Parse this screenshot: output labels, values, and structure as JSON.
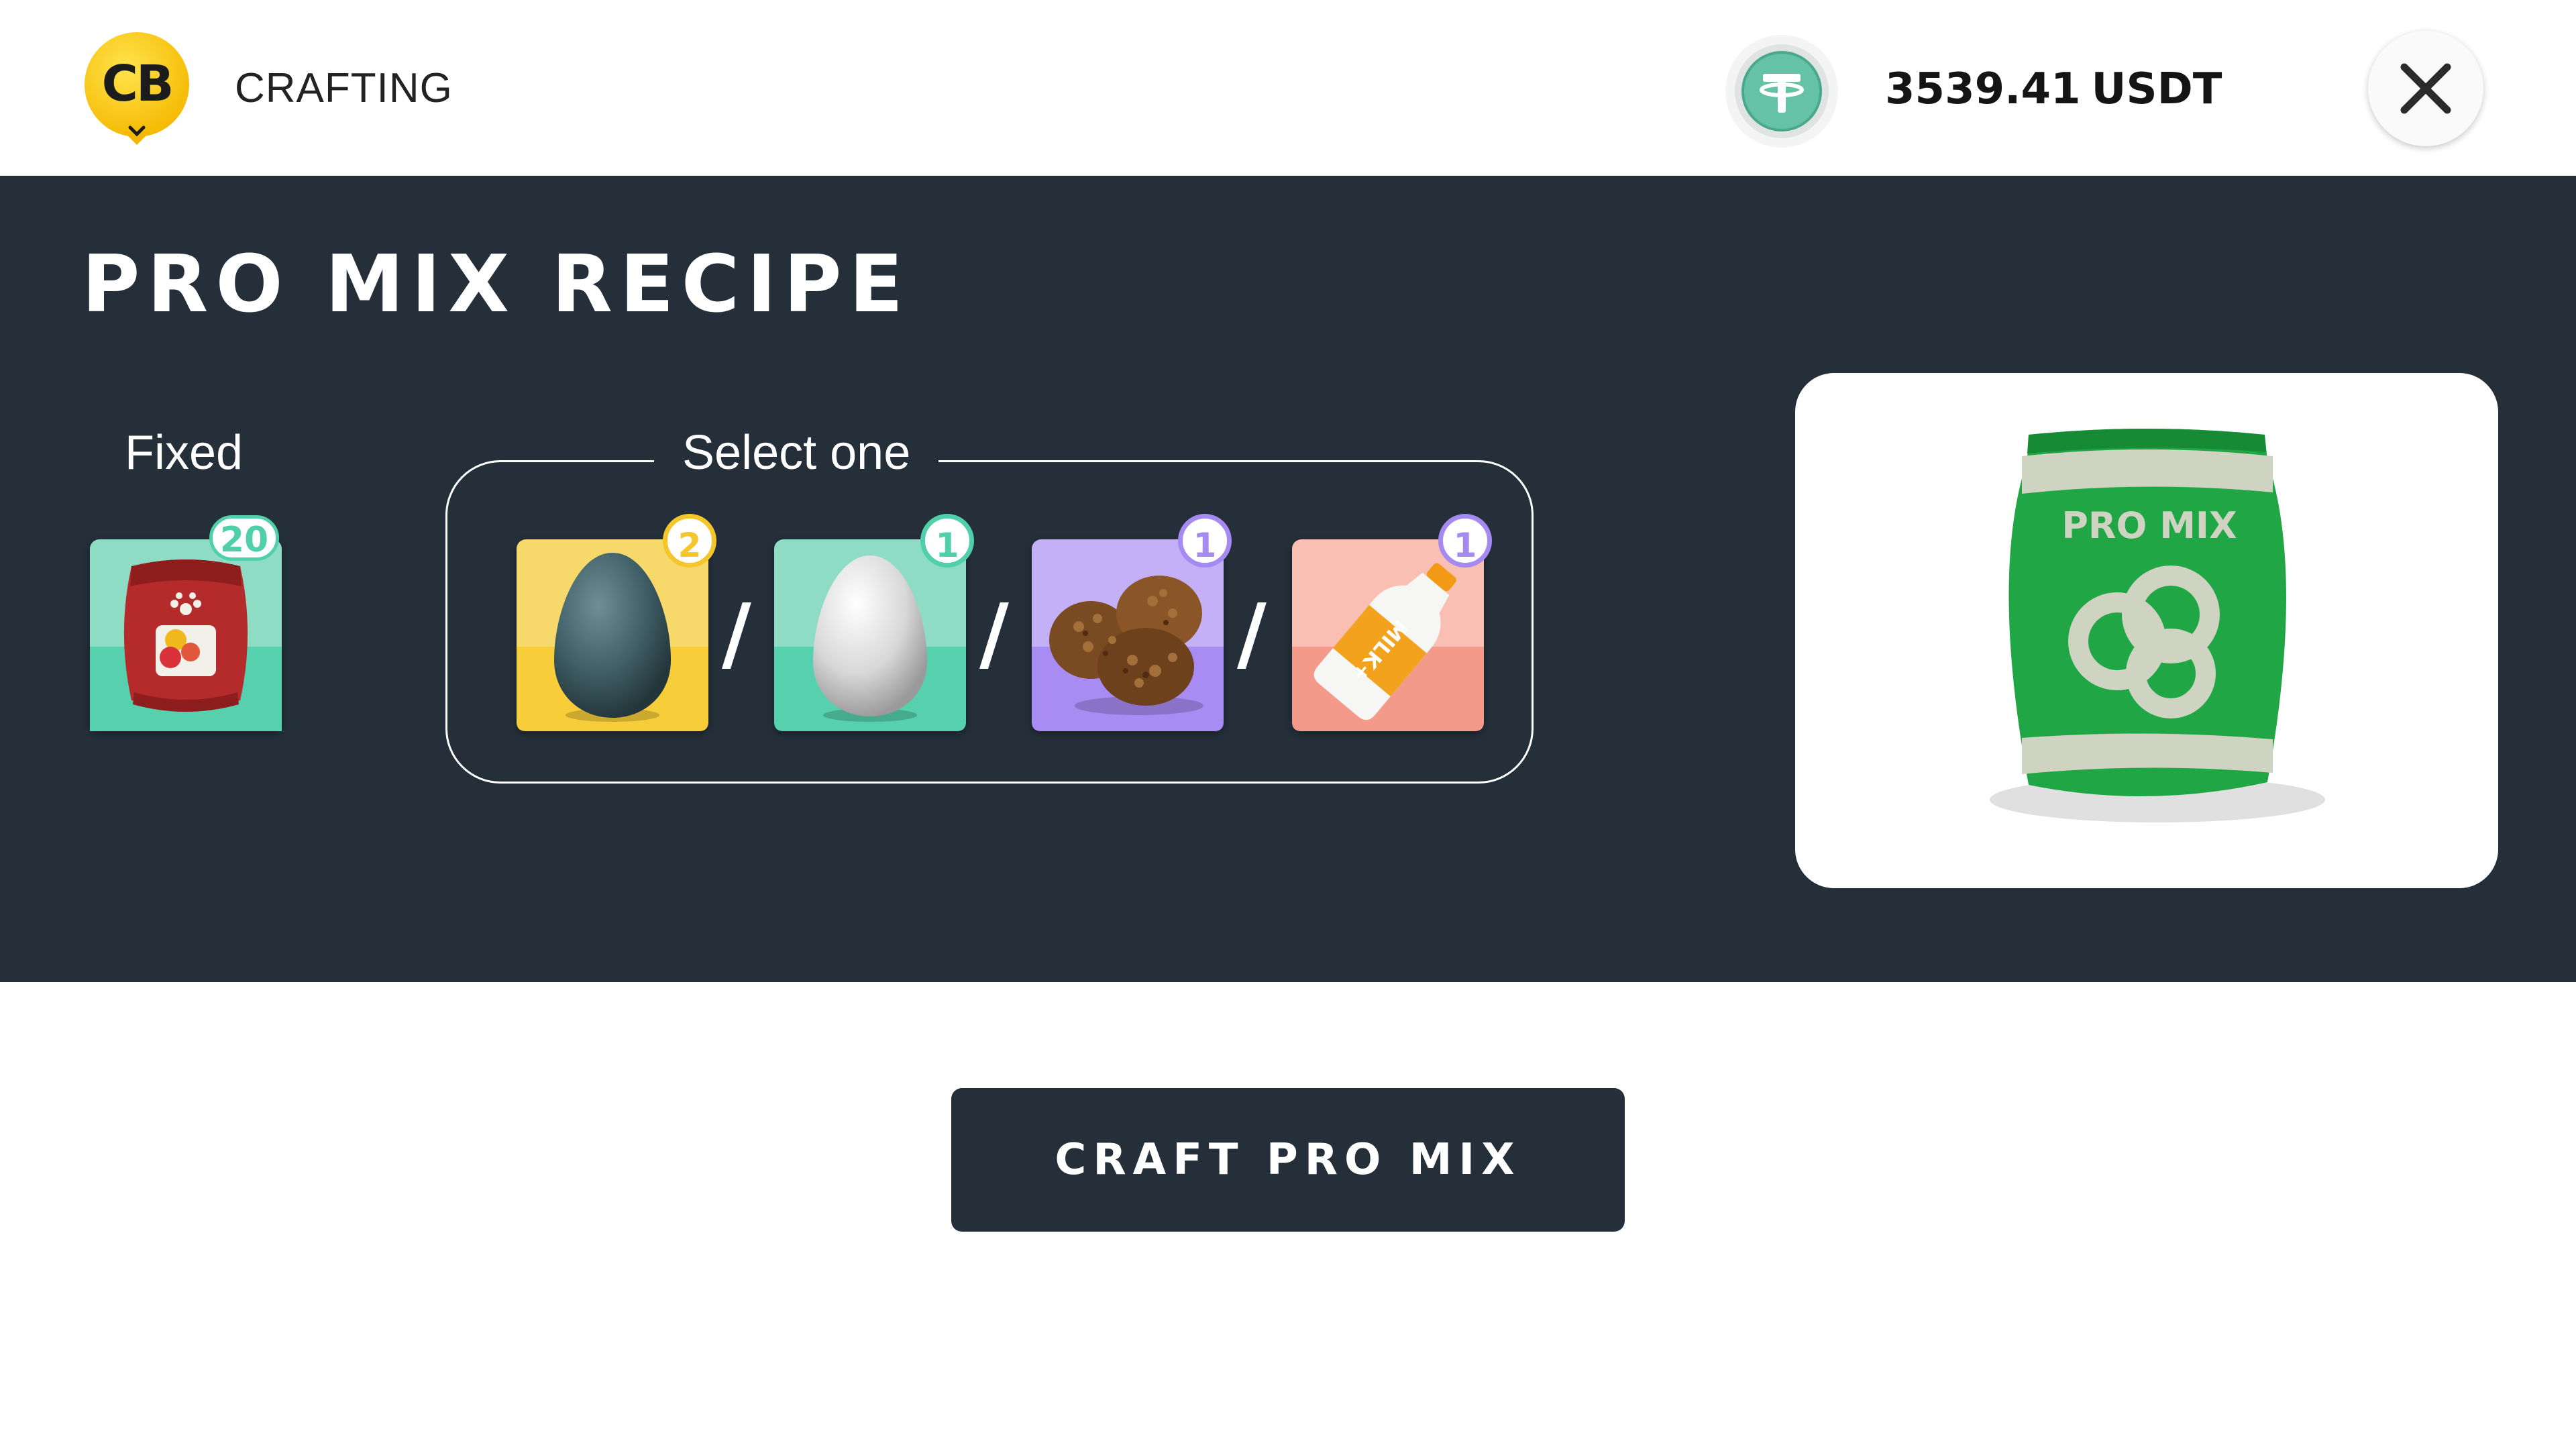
{
  "header": {
    "logo_text": "CB",
    "app_title": "CRAFTING",
    "coin_icon": "tether-coin-icon",
    "balance_amount": "3539.41",
    "balance_currency": "USDT",
    "close_icon": "close-icon"
  },
  "recipe": {
    "title": "PRO MIX RECIPE",
    "fixed": {
      "label": "Fixed",
      "item": {
        "icon": "red-feed-bag-icon",
        "count": "20",
        "color": "#4fcfaa"
      }
    },
    "select": {
      "label": "Select one",
      "separator": "/",
      "items": [
        {
          "icon": "dark-egg-icon",
          "count": "2",
          "badge_color": "#f5c62b",
          "bg_top": "#f7d86a",
          "bg_bottom": "#f8cd3a"
        },
        {
          "icon": "white-egg-icon",
          "count": "1",
          "badge_color": "#4fcfaa",
          "bg_top": "#8fdcc4",
          "bg_bottom": "#56d0ad"
        },
        {
          "icon": "truffle-icon",
          "count": "1",
          "badge_color": "#a58af2",
          "bg_top": "#c3b0f6",
          "bg_bottom": "#a98bf4"
        },
        {
          "icon": "milk-bottle-icon",
          "count": "1",
          "badge_color": "#a58af2",
          "bg_top": "#f8bfb2",
          "bg_bottom": "#f49a8a"
        }
      ]
    },
    "result": {
      "icon": "pro-mix-bag-icon",
      "bag_label": "PRO MIX"
    }
  },
  "craft_button": {
    "label": "CRAFT PRO MIX"
  }
}
